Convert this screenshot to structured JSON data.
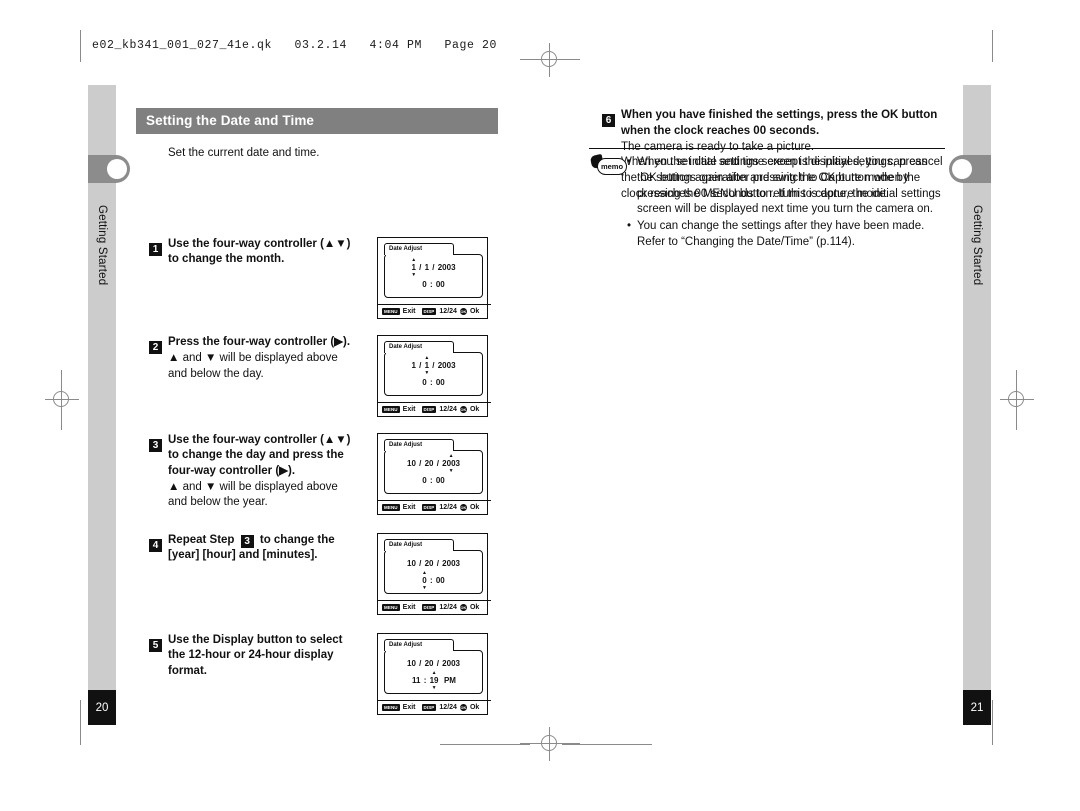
{
  "slug": "e02_kb341_001_027_41e.qk   03.2.14   4:04 PM   Page 20",
  "sidebar": {
    "left": {
      "chapter_label": "Getting Started",
      "page_number": "20"
    },
    "right": {
      "chapter_label": "Getting Started",
      "page_number": "21"
    }
  },
  "section": {
    "heading": "Setting the Date and Time",
    "intro": "Set the current date and time."
  },
  "lcd_common": {
    "title": "Date Adjust",
    "exit_label": "Exit",
    "menu_icon": "MENU",
    "disp_icon": "DISP",
    "format_label": "12/24",
    "ok_icon": "OK",
    "ok_label": "Ok",
    "arrow_up": "▲",
    "arrow_down": "▼"
  },
  "steps": [
    {
      "number": "1",
      "title": "Use the four-way controller (▲▼) to change the month.",
      "sub": "",
      "lcd": {
        "date": {
          "month": "1",
          "day": "1",
          "year": "2003",
          "highlight": "month"
        },
        "time": {
          "hour": "0",
          "minute": "00",
          "meridiem": "",
          "highlight": ""
        }
      }
    },
    {
      "number": "2",
      "title": "Press the four-way controller (▶).",
      "sub": "▲ and ▼ will be displayed above and below the day.",
      "lcd": {
        "date": {
          "month": "1",
          "day": "1",
          "year": "2003",
          "highlight": "day"
        },
        "time": {
          "hour": "0",
          "minute": "00",
          "meridiem": "",
          "highlight": ""
        }
      }
    },
    {
      "number": "3",
      "title": "Use the four-way controller (▲▼) to change the day and press the four-way controller (▶).",
      "sub": "▲ and ▼ will be displayed above and below the year.",
      "lcd": {
        "date": {
          "month": "10",
          "day": "20",
          "year": "2003",
          "highlight": "year"
        },
        "time": {
          "hour": "0",
          "minute": "00",
          "meridiem": "",
          "highlight": ""
        }
      }
    },
    {
      "number": "4",
      "title_pre": "Repeat Step",
      "title_badge": "3",
      "title_post": "to change the [year] [hour] and [minutes].",
      "sub": "",
      "lcd": {
        "date": {
          "month": "10",
          "day": "20",
          "year": "2003",
          "highlight": ""
        },
        "time": {
          "hour": "0",
          "minute": "00",
          "meridiem": "",
          "highlight": "hour"
        }
      }
    },
    {
      "number": "5",
      "title": "Use the Display button to select the 12-hour or 24-hour display format.",
      "sub": "",
      "lcd": {
        "date": {
          "month": "10",
          "day": "20",
          "year": "2003",
          "highlight": ""
        },
        "time": {
          "hour": "11",
          "minute": "19",
          "meridiem": "PM",
          "highlight": "minute"
        }
      }
    }
  ],
  "right_step": {
    "number": "6",
    "bold": "When you have finished the settings, press the OK button when the clock reaches 00 seconds.",
    "lines": [
      "The camera is ready to take a picture.",
      "When you set date and time except the initial settings, press the OK button again after pressing the OK button when the clock reaches 00 seconds to return to capture mode."
    ]
  },
  "memo": {
    "icon_label": "memo",
    "bullet": "•",
    "items": [
      "When the initial settings screen is displayed, you can cancel the settings operation and switch to Capture mode by pressing the MENU button. If this is done, the initial settings screen will be displayed next time you turn the camera on.",
      "You can change the settings after they have been made. Refer to “Changing the Date/Time” (p.114)."
    ]
  }
}
